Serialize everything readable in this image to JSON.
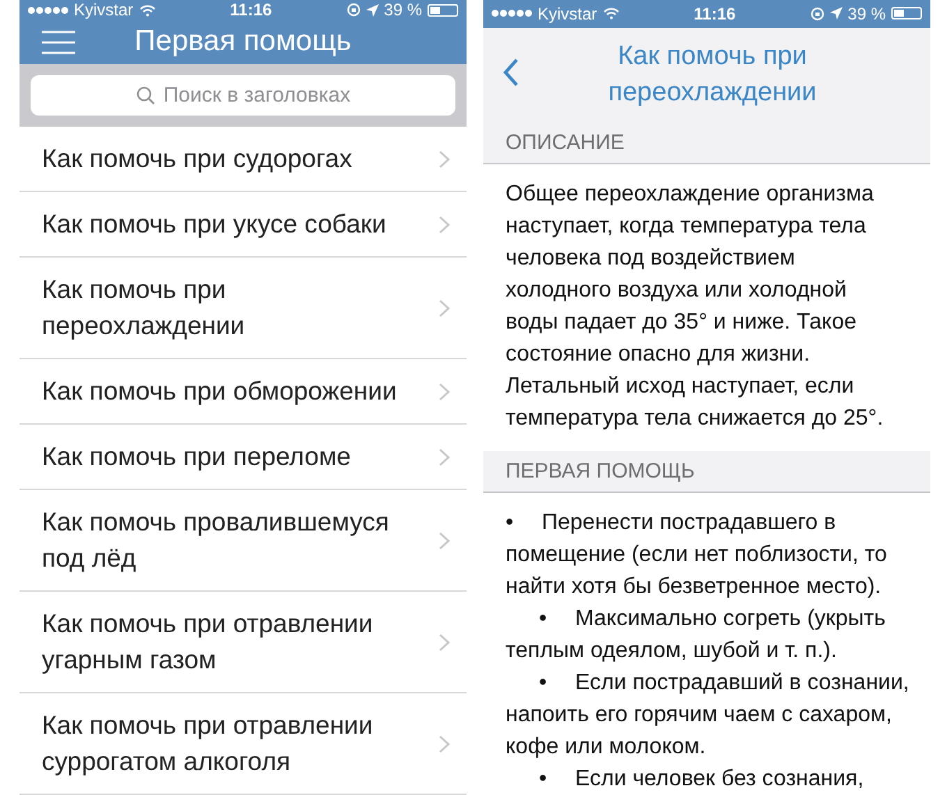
{
  "screens": [
    {
      "status_bar": {
        "carrier": "Kyivstar",
        "time": "11:16",
        "battery": "39 %"
      },
      "nav": {
        "title": "Первая помощь"
      },
      "search": {
        "placeholder": "Поиск в заголовках"
      },
      "items": [
        {
          "title": "Как помочь при судорогах"
        },
        {
          "title": "Как помочь при укусе собаки"
        },
        {
          "title": "Как помочь при переохлаждении"
        },
        {
          "title": "Как помочь при обморожении"
        },
        {
          "title": "Как помочь при переломе"
        },
        {
          "title": "Как помочь провалившемуся под лёд"
        },
        {
          "title": "Как помочь при отравлении угарным газом"
        },
        {
          "title": "Как помочь при отравлении суррогатом алкоголя"
        }
      ]
    },
    {
      "status_bar": {
        "carrier": "Kyivstar",
        "time": "11:16",
        "battery": "39 %"
      },
      "nav": {
        "title": "Как помочь при переохлаждении"
      },
      "sections": [
        {
          "header": "ОПИСАНИЕ",
          "kind": "text",
          "text": "Общее переохлаждение организма наступает, когда температура тела человека под воздействием холодного воздуха или холодной воды падает до 35° и ниже. Такое состояние опасно для жизни. Летальный исход наступает, если температура тела снижается до 25°."
        },
        {
          "header": "ПЕРВАЯ ПОМОЩЬ",
          "kind": "bullets",
          "bullets": [
            {
              "bullet": "•",
              "indented": false,
              "text": "Перенести пострадавшего в помещение (если нет поблизости, то найти хотя бы безветренное место)."
            },
            {
              "bullet": "•",
              "indented": true,
              "text": "Максимально согреть (укрыть теплым одеялом, шубой и т. п.)."
            },
            {
              "bullet": "•",
              "indented": true,
              "text": "Если пострадавший в сознании, напоить его горячим чаем с сахаром, кофе или молоком."
            },
            {
              "bullet": "•",
              "indented": true,
              "text": "Если человек без сознания,"
            }
          ]
        }
      ]
    }
  ]
}
